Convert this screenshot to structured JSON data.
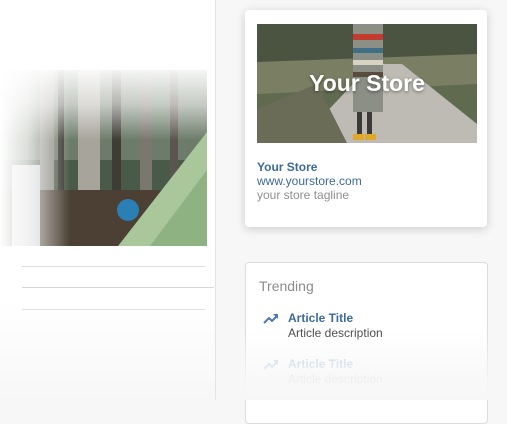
{
  "store_card": {
    "hero_title": "Your Store",
    "name": "Your Store",
    "url": "www.yourstore.com",
    "tagline": "your store tagline"
  },
  "trending": {
    "heading": "Trending",
    "items": [
      {
        "icon": "trending-up-icon",
        "title": "Article Title",
        "description": "Article description"
      },
      {
        "icon": "trending-up-icon",
        "title": "Article Title",
        "description": "Article description"
      }
    ]
  },
  "colors": {
    "link_blue": "#3d6a9b",
    "muted_text": "#8f8f8f",
    "trend_icon": "#4a78b0"
  }
}
